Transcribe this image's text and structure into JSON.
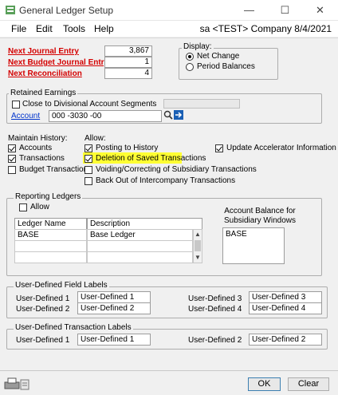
{
  "window": {
    "title": "General Ledger Setup",
    "minimize_glyph": "—",
    "maximize_glyph": "☐",
    "close_glyph": "✕"
  },
  "menu": {
    "items": [
      "File",
      "Edit",
      "Tools",
      "Help"
    ],
    "company": "sa  <TEST> Company  8/4/2021"
  },
  "next_numbers": {
    "journal_label": "Next Journal Entry",
    "journal_value": "3,867",
    "budget_label": "Next Budget Journal Entry",
    "budget_value": "1",
    "reconciliation_label": "Next Reconciliation",
    "reconciliation_value": "4"
  },
  "display": {
    "title": "Display:",
    "options": [
      "Net Change",
      "Period Balances"
    ],
    "selected": "Net Change"
  },
  "retained_earnings": {
    "title": "Retained Earnings",
    "close_divisional_label": "Close to Divisional Account Segments",
    "close_divisional_checked": false,
    "account_label": "Account",
    "account_value": "000 -3030 -00"
  },
  "maintain_history": {
    "title": "Maintain History:",
    "accounts_label": "Accounts",
    "accounts_checked": true,
    "transactions_label": "Transactions",
    "transactions_checked": true,
    "budget_label": "Budget Transactions",
    "budget_checked": false
  },
  "allow": {
    "title": "Allow:",
    "posting_label": "Posting to History",
    "posting_checked": true,
    "deletion_label": "Deletion of Saved Transactions",
    "deletion_checked": true,
    "voiding_label": "Voiding/Correcting of Subsidiary Transactions",
    "voiding_checked": false,
    "backout_label": "Back Out of Intercompany Transactions",
    "backout_checked": false
  },
  "update_accelerator": {
    "label": "Update Accelerator Information",
    "checked": true
  },
  "reporting_ledgers": {
    "title": "Reporting Ledgers",
    "allow_label": "Allow",
    "allow_checked": false,
    "columns": [
      "Ledger Name",
      "Description"
    ],
    "rows": [
      [
        "BASE",
        "Base Ledger"
      ],
      [
        "",
        ""
      ],
      [
        "",
        ""
      ]
    ],
    "account_balance_label": "Account Balance for Subsidiary Windows",
    "account_balance_items": [
      "BASE"
    ]
  },
  "user_defined_field_labels": {
    "title": "User-Defined Field Labels",
    "rows": [
      {
        "label": "User-Defined 1",
        "value": "User-Defined 1"
      },
      {
        "label": "User-Defined 2",
        "value": "User-Defined 2"
      },
      {
        "label": "User-Defined 3",
        "value": "User-Defined 3"
      },
      {
        "label": "User-Defined 4",
        "value": "User-Defined 4"
      }
    ]
  },
  "user_defined_transaction_labels": {
    "title": "User-Defined Transaction Labels",
    "rows": [
      {
        "label": "User-Defined 1",
        "value": "User-Defined 1"
      },
      {
        "label": "User-Defined 2",
        "value": "User-Defined 2"
      }
    ]
  },
  "buttons": {
    "ok": "OK",
    "clear": "Clear"
  },
  "colors": {
    "required_label": "#d40000",
    "highlight": "#ffff33",
    "link": "#0033cc"
  }
}
